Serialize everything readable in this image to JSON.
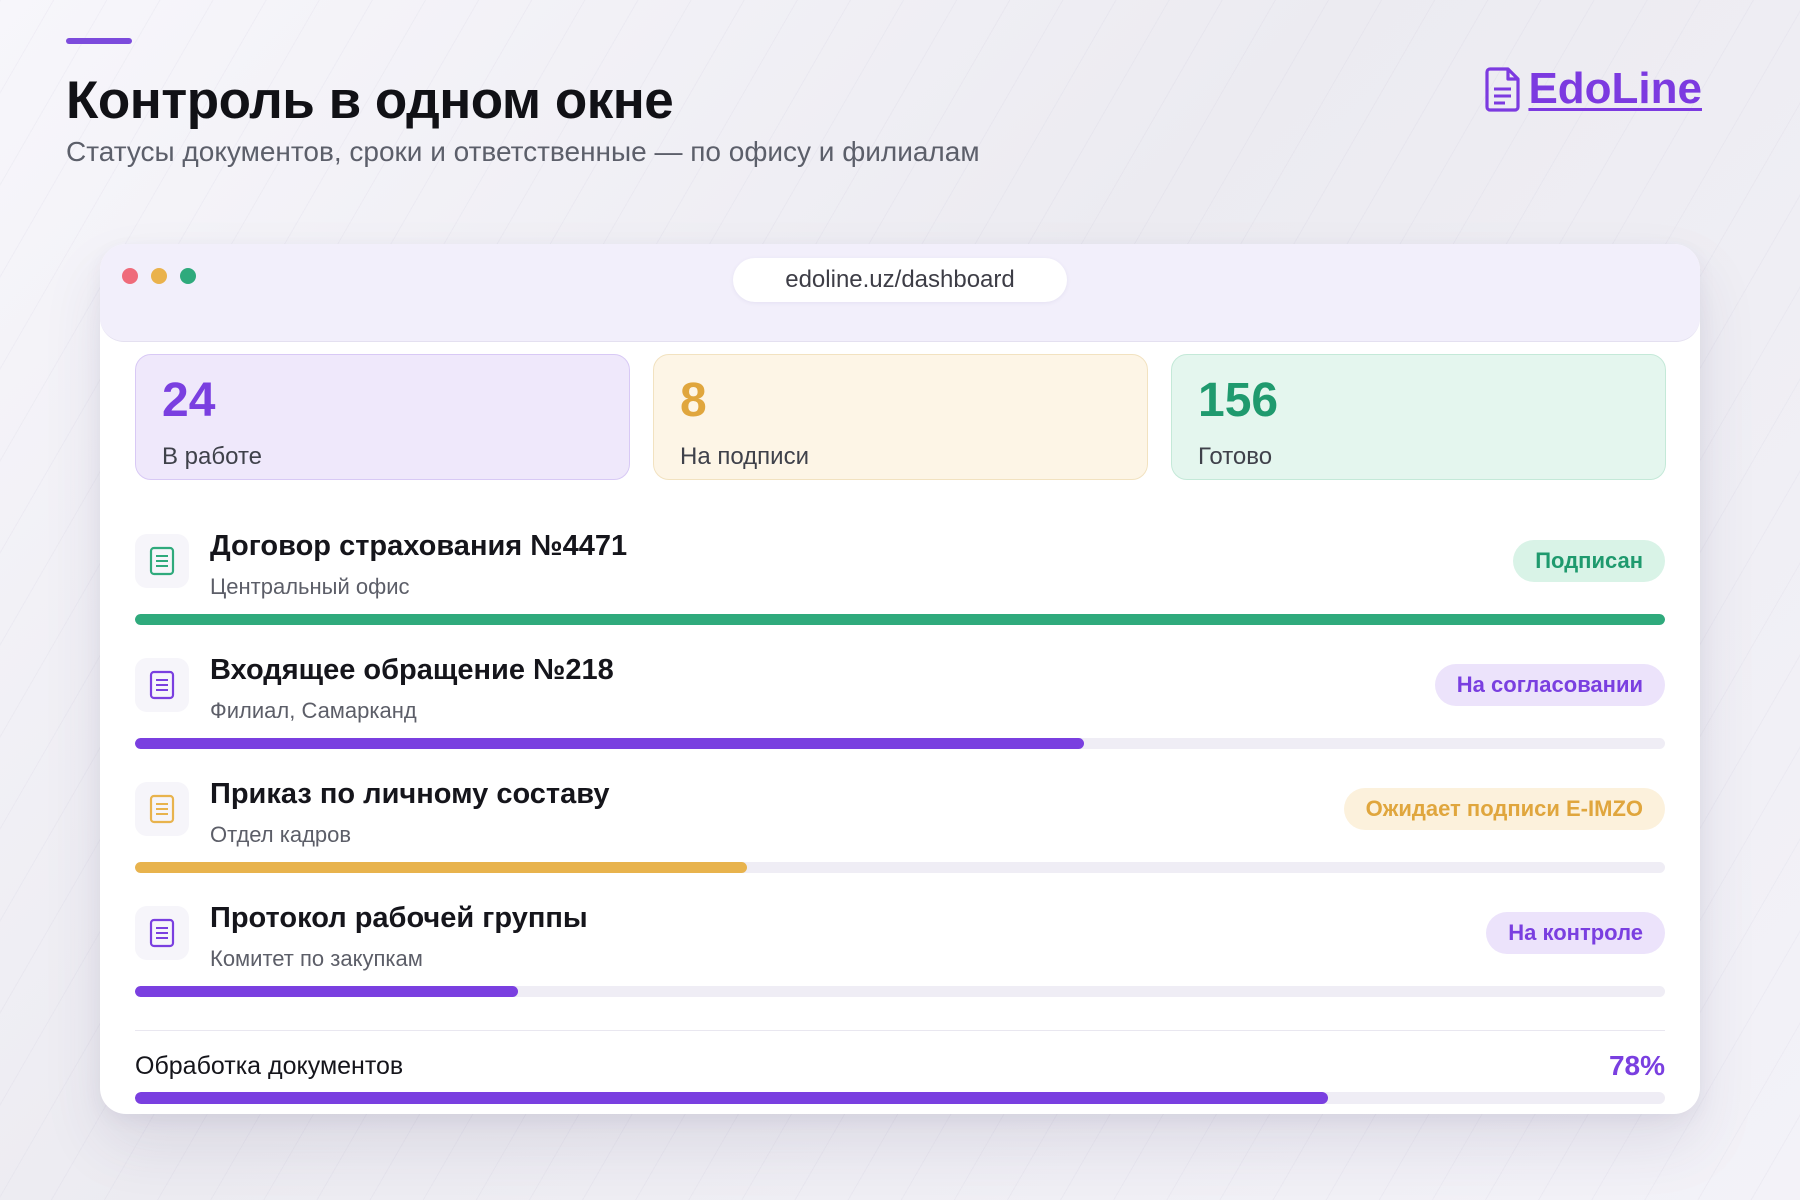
{
  "header": {
    "title": "Контроль в одном окне",
    "subtitle": "Статусы документов, сроки и ответственные — по офису и филиалам",
    "logo_text": "EdoLine",
    "brand_color": "#7c3ae0"
  },
  "browser": {
    "url": "edoline.uz/dashboard"
  },
  "stats": [
    {
      "value": "24",
      "label": "В работе",
      "color": "#7a3fe0"
    },
    {
      "value": "8",
      "label": "На подписи",
      "color": "#e0a63d"
    },
    {
      "value": "156",
      "label": "Готово",
      "color": "#1f9a6e"
    }
  ],
  "documents": [
    {
      "title": "Договор страхования №4471",
      "subtitle": "Центральный офис",
      "status": "Подписан",
      "progress": 1.0,
      "color": "#2faa7c",
      "badge_bg": "#d9f3e7",
      "badge_color": "#1f9a6e"
    },
    {
      "title": "Входящее обращение №218",
      "subtitle": "Филиал, Самарканд",
      "status": "На согласовании",
      "progress": 0.62,
      "color": "#7a3fe0",
      "badge_bg": "#ece3fb",
      "badge_color": "#7a3fe0"
    },
    {
      "title": "Приказ по личному составу",
      "subtitle": "Отдел кадров",
      "status": "Ожидает подписи E-IMZO",
      "progress": 0.4,
      "color": "#e8b34d",
      "badge_bg": "#fcf1dc",
      "badge_color": "#e0a63d"
    },
    {
      "title": "Протокол рабочей группы",
      "subtitle": "Комитет по закупкам",
      "status": "На контроле",
      "progress": 0.25,
      "color": "#7a3fe0",
      "badge_bg": "#ece3fb",
      "badge_color": "#7a3fe0"
    }
  ],
  "summary": {
    "label": "Обработка документов",
    "percent_text": "78%",
    "progress": 0.78
  }
}
